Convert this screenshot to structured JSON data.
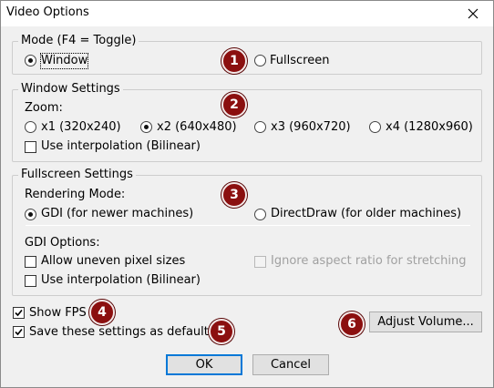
{
  "window": {
    "title": "Video Options"
  },
  "mode": {
    "legend": "Mode (F4 = Toggle)",
    "options": [
      {
        "label": "Window",
        "checked": true
      },
      {
        "label": "Fullscreen",
        "checked": false
      }
    ]
  },
  "window_settings": {
    "legend": "Window Settings",
    "zoom_label": "Zoom:",
    "zoom_options": [
      {
        "label": "x1 (320x240)",
        "checked": false
      },
      {
        "label": "x2 (640x480)",
        "checked": true
      },
      {
        "label": "x3 (960x720)",
        "checked": false
      },
      {
        "label": "x4 (1280x960)",
        "checked": false
      }
    ],
    "interpolation_label": "Use interpolation (Bilinear)"
  },
  "fullscreen_settings": {
    "legend": "Fullscreen Settings",
    "rendering_label": "Rendering Mode:",
    "rendering_options": [
      {
        "label": "GDI (for newer machines)",
        "checked": true
      },
      {
        "label": "DirectDraw (for older machines)",
        "checked": false
      }
    ],
    "gdi_options_label": "GDI Options:",
    "uneven_label": "Allow uneven pixel sizes",
    "aspect_label": "Ignore aspect ratio for stretching",
    "interpolation_label": "Use interpolation (Bilinear)"
  },
  "show_fps_label": "Show FPS",
  "save_default_label": "Save these settings as default",
  "adjust_volume_label": "Adjust Volume...",
  "ok_label": "OK",
  "cancel_label": "Cancel",
  "badges": [
    "1",
    "2",
    "3",
    "4",
    "5",
    "6"
  ],
  "colors": {
    "badge": "#8b0f0f",
    "dialog_bg": "#f0f0f0",
    "focus_border": "#0078d7"
  }
}
